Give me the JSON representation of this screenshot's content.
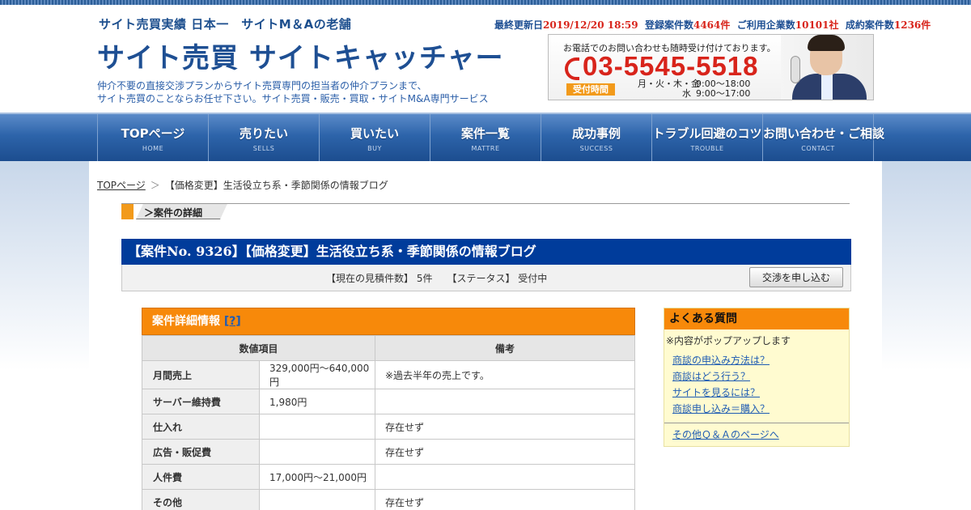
{
  "header": {
    "tagline": "サイト売買実績 日本一　サイトM＆Aの老舗",
    "logo": "サイト売買 サイトキャッチャー",
    "desc_line1": "仲介不要の直接交渉プランからサイト売買専門の担当者の仲介プランまで、",
    "desc_line2": "サイト売買のことならお任せ下さい。サイト売買・販売・買取・サイトM&A専門サービス",
    "stats": {
      "updated_label": "最終更新日",
      "updated_value": "2019/12/20 18:59",
      "listings_label": "登録案件数",
      "listings_value": "4464件",
      "companies_label": "ご利用企業数",
      "companies_value": "10101社",
      "deals_label": "成約案件数",
      "deals_value": "1236件"
    },
    "phone_banner": {
      "note": "お電話でのお問い合わせも随時受け付けております。",
      "number": "03-5545-5518",
      "hours_badge": "受付時間",
      "days_line1": "月・火・木・金",
      "days_line2": "水",
      "times_line1": "9:00～18:00",
      "times_line2": "9:00～17:00"
    }
  },
  "nav": {
    "items": [
      {
        "label": "TOPページ",
        "sub": "HOME"
      },
      {
        "label": "売りたい",
        "sub": "SELLS"
      },
      {
        "label": "買いたい",
        "sub": "BUY"
      },
      {
        "label": "案件一覧",
        "sub": "MATTRE"
      },
      {
        "label": "成功事例",
        "sub": "SUCCESS"
      },
      {
        "label": "トラブル回避のコツ",
        "sub": "TROUBLE"
      },
      {
        "label": "お問い合わせ・ご相談",
        "sub": "CONTACT"
      }
    ]
  },
  "breadcrumb": {
    "home": "TOPページ",
    "sep": "＞",
    "current": "【価格変更】生活役立ち系・季節関係の情報ブログ"
  },
  "section": {
    "label": "＞案件の詳細"
  },
  "listing": {
    "title": "【案件No. 9326】【価格変更】生活役立ち系・季節関係の情報ブログ",
    "status_text": "【現在の見積件数】 5件　　【ステータス】 受付中",
    "negotiate_button": "交渉を申し込む"
  },
  "detail": {
    "heading": "案件詳細情報",
    "help": "[?]",
    "col_item": "数値項目",
    "col_note": "備考",
    "rows": [
      {
        "label": "月間売上",
        "value": "329,000円～640,000円",
        "note": "※過去半年の売上です。"
      },
      {
        "label": "サーバー維持費",
        "value": "1,980円",
        "note": ""
      },
      {
        "label": "仕入れ",
        "value": "",
        "note": "存在せず"
      },
      {
        "label": "広告・販促費",
        "value": "",
        "note": "存在せず"
      },
      {
        "label": "人件費",
        "value": "17,000円～21,000円",
        "note": ""
      },
      {
        "label": "その他",
        "value": "",
        "note": "存在せず"
      }
    ]
  },
  "faq": {
    "heading": "よくある質問",
    "hint": "※内容がポップアップします",
    "links": [
      "商談の申込み方法は？",
      "商談はどう行う？",
      "サイトを見るには？",
      "商談申し込み＝購入？"
    ],
    "more": "その他Ｑ＆Ａのページへ"
  },
  "colors": {
    "brand_blue": "#1e4f93",
    "title_blue": "#003c9b",
    "accent_orange": "#f7890a",
    "alert_red": "#d8241b"
  }
}
